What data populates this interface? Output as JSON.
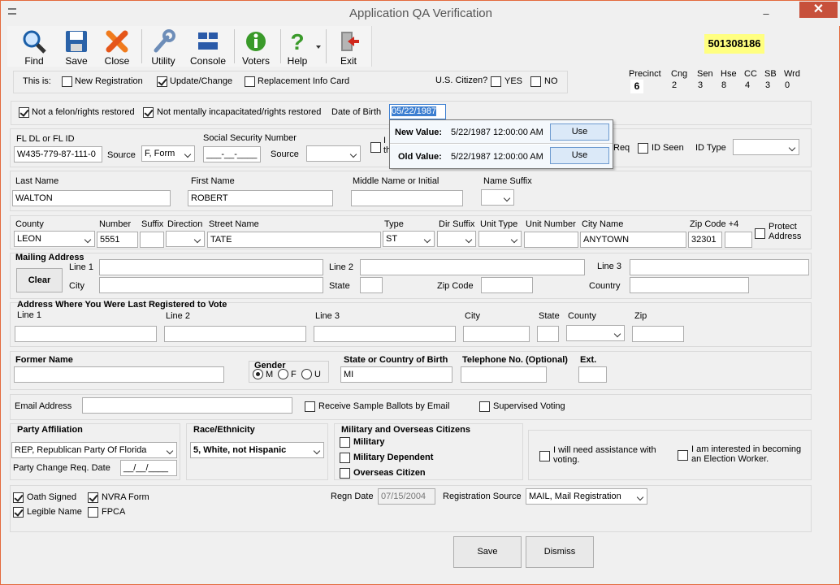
{
  "window": {
    "title": "Application QA Verification",
    "minimize": "–",
    "close": "✕"
  },
  "toolbar": [
    {
      "label": "Find",
      "icon": "magnifier-icon"
    },
    {
      "label": "Save",
      "icon": "floppy-disk-icon"
    },
    {
      "label": "Close",
      "icon": "red-x-icon"
    },
    {
      "label": "Utility",
      "icon": "wrench-icon"
    },
    {
      "label": "Console",
      "icon": "console-icon"
    },
    {
      "label": "Voters",
      "icon": "info-icon"
    },
    {
      "label": "Help",
      "icon": "question-icon"
    },
    {
      "label": "Exit",
      "icon": "exit-door-icon"
    }
  ],
  "record_number": "501308186",
  "districts": {
    "headers": [
      "Precinct",
      "Cng",
      "Sen",
      "Hse",
      "CC",
      "SB",
      "Wrd"
    ],
    "values": [
      "6",
      "2",
      "3",
      "8",
      "4",
      "3",
      "0"
    ]
  },
  "this_is": {
    "label": "This is:",
    "options": [
      {
        "label": "New Registration",
        "checked": false
      },
      {
        "label": "Update/Change",
        "checked": true
      },
      {
        "label": "Replacement Info Card",
        "checked": false
      }
    ]
  },
  "citizen": {
    "label": "U.S. Citizen?",
    "yes": "YES",
    "no": "NO"
  },
  "eligibility": {
    "felon": "Not a felon/rights restored",
    "mental": "Not mentally incapacitated/rights restored",
    "dob_label": "Date of Birth",
    "dob_value": "05/22/1987"
  },
  "dob_popup": {
    "new_label": "New Value:",
    "new_value": "5/22/1987 12:00:00 AM",
    "old_label": "Old Value:",
    "old_value": "5/22/1987 12:00:00 AM",
    "use": "Use"
  },
  "ids": {
    "fldl_label": "FL DL or FL ID",
    "fldl_value": "W435-779-87-111-0",
    "source_label": "Source",
    "source_value": "F, Form",
    "ssn_label": "Social Security Number",
    "ssn_value": "___-__-____",
    "ssn_source_label": "Source",
    "partial_i": "I",
    "partial_th": "th",
    "req": "Req",
    "id_seen": "ID Seen",
    "id_type": "ID Type"
  },
  "name": {
    "last_label": "Last Name",
    "last": "WALTON",
    "first_label": "First Name",
    "first": "ROBERT",
    "middle_label": "Middle Name or Initial",
    "middle": "",
    "suffix_label": "Name Suffix"
  },
  "address": {
    "county_label": "County",
    "county": "LEON",
    "number_label": "Number",
    "number": "5551",
    "suffix_label": "Suffix",
    "direction_label": "Direction",
    "street_label": "Street Name",
    "street": "TATE",
    "type_label": "Type",
    "type": "ST",
    "dir_suffix_label": "Dir Suffix",
    "unit_type_label": "Unit Type",
    "unit_number_label": "Unit Number",
    "city_label": "City Name",
    "city": "ANYTOWN",
    "zip_label": "Zip Code +4",
    "zip": "32301",
    "protect_label_1": "Protect",
    "protect_label_2": "Address"
  },
  "mailing": {
    "title": "Mailing Address",
    "clear": "Clear",
    "line1": "Line 1",
    "line2": "Line 2",
    "line3": "Line 3",
    "city": "City",
    "state": "State",
    "zip": "Zip Code",
    "country": "Country"
  },
  "last_registered": {
    "title": "Address Where You Were Last Registered to Vote",
    "line1": "Line 1",
    "line2": "Line 2",
    "line3": "Line 3",
    "city": "City",
    "state": "State",
    "county": "County",
    "zip": "Zip"
  },
  "misc": {
    "former_name": "Former Name",
    "gender": "Gender",
    "m": "M",
    "f": "F",
    "u": "U",
    "birth_label": "State or Country of Birth",
    "birth_value": "MI",
    "phone_label": "Telephone No. (Optional)",
    "ext_label": "Ext."
  },
  "email": {
    "label": "Email Address",
    "sample_ballots": "Receive Sample Ballots by Email",
    "supervised": "Supervised Voting"
  },
  "party": {
    "title": "Party Affiliation",
    "value": "REP, Republican Party Of Florida",
    "change_label": "Party Change Req. Date",
    "change_value": "__/__/____"
  },
  "race": {
    "title": "Race/Ethnicity",
    "value": "5, White, not Hispanic"
  },
  "military": {
    "title": "Military and Overseas Citizens",
    "military": "Military",
    "dependent": "Military Dependent",
    "overseas": "Overseas Citizen"
  },
  "assist": {
    "need_1": "I will need assistance with",
    "need_2": "voting.",
    "worker_1": "I am interested in becoming",
    "worker_2": "an Election Worker."
  },
  "bottom": {
    "oath": "Oath Signed",
    "nvra": "NVRA Form",
    "legible": "Legible Name",
    "fpca": "FPCA",
    "regn_label": "Regn Date",
    "regn_value": "07/15/2004",
    "source_label": "Registration Source",
    "source_value": "MAIL, Mail Registration"
  },
  "actions": {
    "save": "Save",
    "dismiss": "Dismiss"
  }
}
